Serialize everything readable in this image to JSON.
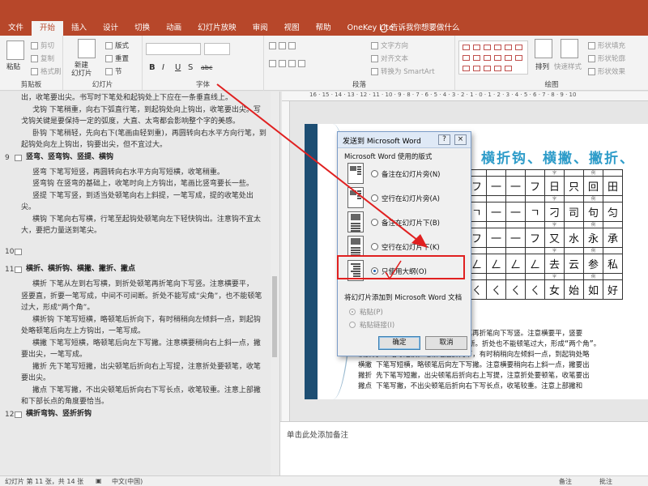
{
  "ribbon": {
    "tabs": [
      "文件",
      "开始",
      "插入",
      "设计",
      "切换",
      "动画",
      "幻灯片放映",
      "审阅",
      "视图",
      "帮助",
      "OneKey Lite"
    ],
    "active_tab": "开始",
    "tell_me": "告诉我你想要做什么",
    "clipboard": {
      "paste": "粘贴",
      "cut": "剪切",
      "copy": "复制",
      "format_painter": "格式刷",
      "label": "剪贴板"
    },
    "slides": {
      "new_slide": "新建",
      "new_slide_2": "幻灯片",
      "layout": "版式",
      "reset": "重置",
      "section": "节",
      "label": "幻灯片"
    },
    "font": {
      "bold": "B",
      "italic": "I",
      "underline": "U",
      "shadow": "S",
      "strike": "abc",
      "label": "字体"
    },
    "paragraph": {
      "text_direction": "文字方向",
      "align_text": "对齐文本",
      "smartart": "转换为 SmartArt",
      "label": "段落"
    },
    "drawing": {
      "arrange": "排列",
      "quick_styles": "快速样式",
      "shape_fill": "形状填充",
      "shape_outline": "形状轮廓",
      "shape_effects": "形状效果",
      "label": "绘图"
    }
  },
  "outline": {
    "lines": [
      {
        "text": "出，收笔要出尖。书写时下笔处和起钩处上下应在一条垂直线上。",
        "type": "body"
      },
      {
        "text": "戈钩 下笔稍重，向右下弧直行笔，到起钩处向上钩出，收笔要出尖。写",
        "type": "body"
      },
      {
        "text": "戈钩关键是要保持一定的弧度，大直、太弯都会影响整个字的美感。",
        "type": "body"
      },
      {
        "text": "卧钩 下笔稍轻，先向右下(笔画由轻到重)，再圆转向右水平方向行笔，到",
        "type": "body"
      },
      {
        "text": "起钩处向左上钩出，钩要出尖，但不宜过大。",
        "type": "body"
      },
      {
        "text": "竖弯、竖弯钩、竖提、横钩",
        "type": "head",
        "num": "9"
      },
      {
        "text": "竖弯 下笔写短竖，再圆转向右水平方向写短横，收笔稍重。",
        "type": "body"
      },
      {
        "text": "竖弯钩 在竖弯的基础上，收笔时向上方钩出，笔画比竖弯要长一些。",
        "type": "body"
      },
      {
        "text": "竖提 下笔写竖，到适当处顿笔向右上斜提，一笔写成，提的收笔处出",
        "type": "body"
      },
      {
        "text": "尖。",
        "type": "body"
      },
      {
        "text": "横钩 下笔向右写横，行笔至起钩处顿笔向左下轻快钩出。注意钩不宜太",
        "type": "body"
      },
      {
        "text": "大，要把力量送到笔尖。",
        "type": "body"
      },
      {
        "text": "",
        "type": "empty",
        "num": "10"
      },
      {
        "text": "横折、横折钩、横撇、撇折、撇点",
        "type": "head",
        "num": "11"
      },
      {
        "text": "横折 下笔从左到右写横，到折处顿笔再折笔向下写竖。注意横要平，",
        "type": "body"
      },
      {
        "text": "竖要直，折要一笔写成，中间不可间断。折处不能写成“尖角”，也不能顿笔",
        "type": "body"
      },
      {
        "text": "过大，形成“两个角”。",
        "type": "body"
      },
      {
        "text": "横折钩 下笔写短横，略顿笔后折向下，有时稍稍向左倾斜一点，到起钩",
        "type": "body"
      },
      {
        "text": "处略顿笔后向左上方钩出，一笔写成。",
        "type": "body"
      },
      {
        "text": "横撇 下笔写短横，略顿笔后向左下写撇。注意横要稍向右上斜一点，撇",
        "type": "body"
      },
      {
        "text": "要出尖，一笔写成。",
        "type": "body"
      },
      {
        "text": "撇折 先下笔写短撇，出尖顿笔后折向右上写提，注意折处要顿笔，收笔",
        "type": "body"
      },
      {
        "text": "要出尖。",
        "type": "body"
      },
      {
        "text": "撇点 下笔写撇，不出尖顿笔后折向右下写长点，收笔较重。注意上部撇",
        "type": "body"
      },
      {
        "text": "和下部长点的角度要恰当。",
        "type": "body"
      },
      {
        "text": "横折弯钩、竖折折钩",
        "type": "head",
        "num": "12"
      }
    ]
  },
  "slide": {
    "title": "横折钩、横撇、撇折、",
    "table_rows": [
      [
        "フ",
        "一",
        "一",
        "フ",
        "日",
        "只",
        "回",
        "田"
      ],
      [
        "ㄱ",
        "一",
        "一",
        "ㄱ",
        "刁",
        "司",
        "句",
        "匀"
      ],
      [
        "フ",
        "一",
        "一",
        "フ",
        "又",
        "水",
        "永",
        "承"
      ],
      [
        "ㄥ",
        "ㄥ",
        "ㄥ",
        "ㄥ",
        "去",
        "云",
        "参",
        "私"
      ],
      [
        "ㄑ",
        "ㄑ",
        "ㄑ",
        "ㄑ",
        "女",
        "始",
        "如",
        "好"
      ]
    ],
    "header_cells": [
      "",
      "",
      "",
      "",
      "字",
      "",
      "例",
      ""
    ],
    "notes_lines": [
      "横折 下笔从左到右写横，到折处顿笔再折笔向下写竖。注意横要平，竖要",
      "竖要直，折要一笔写成，中间不可间断。折处也不能顿笔过大，形成“两个角”。",
      "横折钩 下笔写短横，略顿笔后折向下，有时稍稍向左倾斜一点，到起钩处略",
      "横撇 下笔写短横，略顿笔后向左下写撇。注意横要稍向右上斜一点，撇要出",
      "撇折 先下笔写短撇，出尖顿笔后折向右上写提，注意折处要顿笔，收笔要出",
      "撇点 下笔写撇，不出尖顿笔后折向右下写长点，收笔较重。注意上部撇和"
    ]
  },
  "notes_placeholder": "单击此处添加备注",
  "status": {
    "slide_info": "幻灯片 第 11 张，共 14 张",
    "language": "中文(中国)",
    "notes": "备注",
    "comments": "批注"
  },
  "dialog": {
    "title": "发送到 Microsoft Word",
    "help": "?",
    "close": "×",
    "layout_section": "Microsoft Word 使用的版式",
    "options": [
      {
        "label": "备注在幻灯片旁(N)",
        "selected": false
      },
      {
        "label": "空行在幻灯片旁(A)",
        "selected": false
      },
      {
        "label": "备注在幻灯片下(B)",
        "selected": false
      },
      {
        "label": "空行在幻灯片下(K)",
        "selected": false
      },
      {
        "label": "只使用大纲(O)",
        "selected": true
      }
    ],
    "add_section": "将幻灯片添加到 Microsoft Word 文档",
    "paste": "粘贴(P)",
    "paste_link": "粘贴链接(I)",
    "ok": "确定",
    "cancel": "取消"
  },
  "colors": {
    "accent": "#b7472a",
    "highlight": "#e02020",
    "slide_title": "#2e9cc9"
  }
}
